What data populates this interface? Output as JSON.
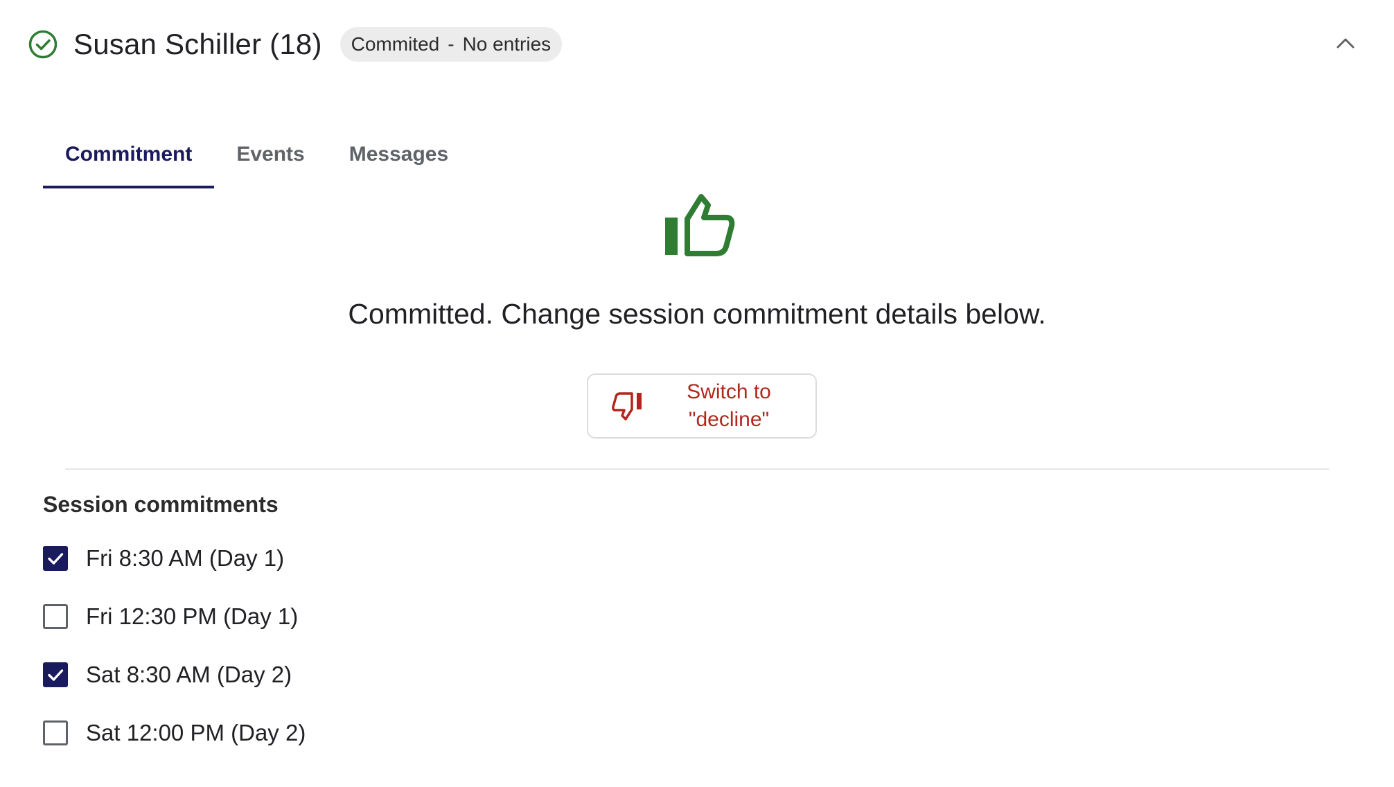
{
  "header": {
    "name": "Susan Schiller (18)",
    "status_chip": {
      "status": "Commited",
      "separator": "-",
      "entries": "No entries"
    }
  },
  "tabs": [
    {
      "label": "Commitment",
      "active": true
    },
    {
      "label": "Events",
      "active": false
    },
    {
      "label": "Messages",
      "active": false
    }
  ],
  "commitment": {
    "message": "Committed. Change session commitment details below.",
    "switch_button_line1": "Switch to",
    "switch_button_line2": "\"decline\""
  },
  "sessions": {
    "title": "Session commitments",
    "items": [
      {
        "label": "Fri 8:30 AM (Day 1)",
        "checked": true
      },
      {
        "label": "Fri 12:30 PM (Day 1)",
        "checked": false
      },
      {
        "label": "Sat 8:30 AM (Day 2)",
        "checked": true
      },
      {
        "label": "Sat 12:00 PM (Day 2)",
        "checked": false
      }
    ]
  },
  "icons": {
    "status": "check-circle-icon",
    "collapse": "chevron-up-icon",
    "commit": "thumbs-up-icon",
    "decline": "thumbs-down-icon"
  },
  "colors": {
    "accent": "#1a1a5e",
    "success": "#2e7d32",
    "danger": "#b3261e",
    "chip_bg": "#ececec"
  }
}
